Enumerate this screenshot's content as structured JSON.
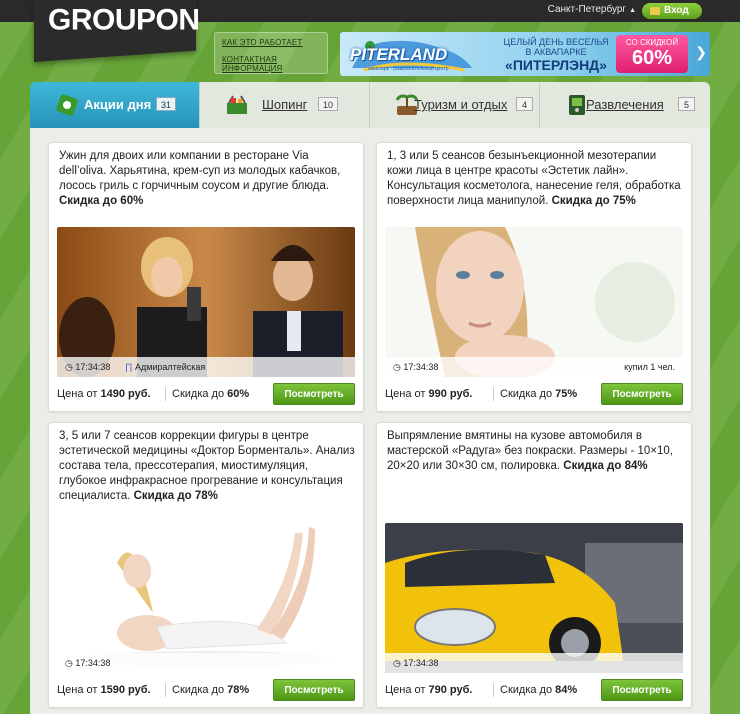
{
  "header": {
    "logo": "GROUPON",
    "city": "Санкт-Петербург",
    "city_arrow": "▲",
    "login": "Вход",
    "links": [
      "КАК ЭТО РАБОТАЕТ",
      "КОНТАКТНАЯ ИНФОРМАЦИЯ"
    ]
  },
  "banner": {
    "logo_text": "PITERLAND",
    "logo_sub": "аквапарк · развлекательный центр",
    "line1": "ЦЕЛЫЙ ДЕНЬ ВЕСЕЛЬЯ",
    "line2": "В АКВАПАРКЕ",
    "line3": "«ПИТЕРЛЭНД»",
    "sale_label": "СО СКИДКОЙ",
    "sale_value": "60%"
  },
  "tabs": [
    {
      "label": "Акции дня",
      "count": "31"
    },
    {
      "label": "Шопинг",
      "count": "10"
    },
    {
      "label": "Туризм и отдых",
      "count": "4"
    },
    {
      "label": "Развлечения",
      "count": "5"
    }
  ],
  "deals": [
    {
      "text": "Ужин для двоих или компании в ресторане Via dell’oliva. Харьятина, крем-суп из молодых кабачков, лосось гриль с горчичным соусом и другие блюда.",
      "discount_text": "Скидка до 60%",
      "time": "17:34:38",
      "metro": "Адмиралтейская",
      "bought": "",
      "price_prefix": "Цена от",
      "price": "1490 руб.",
      "disc_prefix": "Скидка до",
      "disc": "60%",
      "button": "Посмотреть"
    },
    {
      "text": "1, 3 или 5 сеансов безынъекционной мезотерапии кожи лица в центре красоты «Эстетик лайн». Консультация косметолога, нанесение геля, обработка поверхности лица манипулой.",
      "discount_text": "Скидка до 75%",
      "time": "17:34:38",
      "metro": "",
      "bought": "купил 1 чел.",
      "price_prefix": "Цена от",
      "price": "990 руб.",
      "disc_prefix": "Скидка до",
      "disc": "75%",
      "button": "Посмотреть"
    },
    {
      "text": "3, 5 или 7 сеансов коррекции фигуры в центре эстетической медицины «Доктор Борменталь». Анализ состава тела, прессотерапия, миостимуляция, глубокое инфракрасное прогревание и консультация специалиста.",
      "discount_text": "Скидка до 78%",
      "time": "17:34:38",
      "metro": "",
      "bought": "",
      "price_prefix": "Цена от",
      "price": "1590 руб.",
      "disc_prefix": "Скидка до",
      "disc": "78%",
      "button": "Посмотреть"
    },
    {
      "text": "Выпрямление вмятины на кузове автомобиля в мастерской «Радуга» без покраски. Размеры - 10×10, 20×20 или 30×30 см, полировка.",
      "discount_text": "Скидка до 84%",
      "time": "17:34:38",
      "metro": "",
      "bought": "",
      "price_prefix": "Цена от",
      "price": "790 руб.",
      "disc_prefix": "Скидка до",
      "disc": "84%",
      "button": "Посмотреть"
    }
  ],
  "colors": {
    "background": "#6aa93a",
    "active_tab": "#2593b8",
    "button_green": "#5ca82a",
    "banner_sale": "#e01f6f"
  },
  "icons": [
    "clock-icon",
    "metro-icon",
    "ticket-icon",
    "shopping-basket-icon",
    "palm-tree-icon",
    "entertainment-icon",
    "wallet-icon",
    "arrow-right-icon"
  ]
}
